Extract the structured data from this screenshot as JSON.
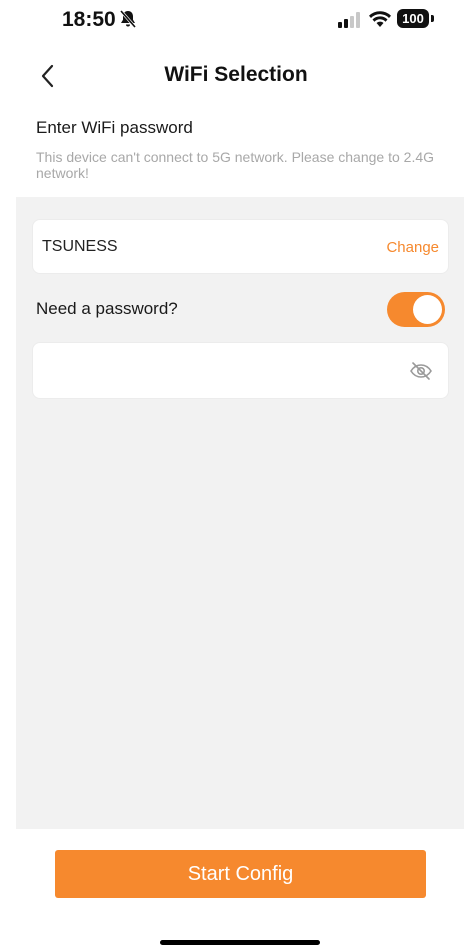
{
  "status_bar": {
    "time": "18:50",
    "battery": "100",
    "icons": [
      "bell-slash-icon",
      "cellular-signal-icon",
      "wifi-icon",
      "battery-icon"
    ]
  },
  "header": {
    "title": "WiFi Selection",
    "back_icon": "chevron-left-icon"
  },
  "section": {
    "title": "Enter WiFi password",
    "notice": "This device can't connect to 5G network. Please change to 2.4G network!"
  },
  "wifi": {
    "ssid": "TSUNESS",
    "change_label": "Change"
  },
  "password": {
    "label": "Need a password?",
    "toggle_on": true,
    "value": "",
    "placeholder": "",
    "visibility_icon": "eye-slash-icon"
  },
  "footer": {
    "start_label": "Start Config"
  },
  "colors": {
    "accent": "#f6892e",
    "background": "#f2f2f2",
    "muted_text": "#a8a8a8"
  }
}
